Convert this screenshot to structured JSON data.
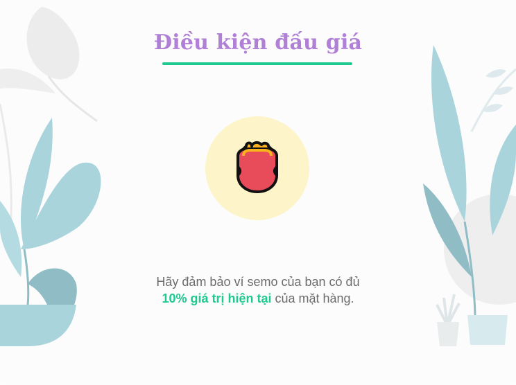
{
  "dialog": {
    "title": "Điều kiện đấu giá",
    "message_line1": "Hãy đảm bảo ví semo của bạn có đủ",
    "message_highlight": "10% giá trị hiện tại",
    "message_line2_rest": " của mặt hàng."
  },
  "icons": {
    "center": "wallet-icon",
    "decor_left": "plant-illustration",
    "decor_right": "plant-illustration"
  },
  "colors": {
    "title": "#b07fd6",
    "accent": "#1fc98f",
    "icon_bg": "#fdf5c9",
    "wallet_body": "#e84b5a",
    "wallet_clasp": "#f7b21e"
  }
}
